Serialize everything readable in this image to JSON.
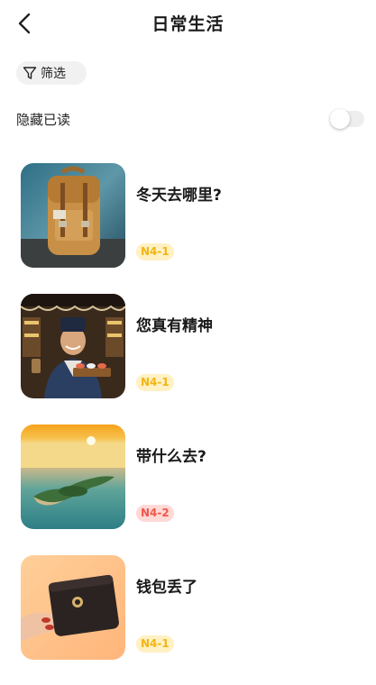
{
  "header": {
    "title": "日常生活",
    "back_icon": "chevron-left-icon"
  },
  "filter": {
    "label": "筛选",
    "icon": "funnel-icon"
  },
  "hide_read": {
    "label": "隐藏已读",
    "enabled": false
  },
  "colors": {
    "badge_yellow_bg": "#fff1c4",
    "badge_yellow_text": "#f2b516",
    "badge_red_bg": "#ffd9d6",
    "badge_red_text": "#f0584a"
  },
  "lessons": [
    {
      "title": "冬天去哪里?",
      "level": "N4-1",
      "level_color": "yellow",
      "image": "backpack"
    },
    {
      "title": "您真有精神",
      "level": "N4-1",
      "level_color": "yellow",
      "image": "sushi-chef"
    },
    {
      "title": "带什么去?",
      "level": "N4-2",
      "level_color": "red",
      "image": "island-sunset"
    },
    {
      "title": "钱包丢了",
      "level": "N4-1",
      "level_color": "yellow",
      "image": "wallet"
    }
  ]
}
